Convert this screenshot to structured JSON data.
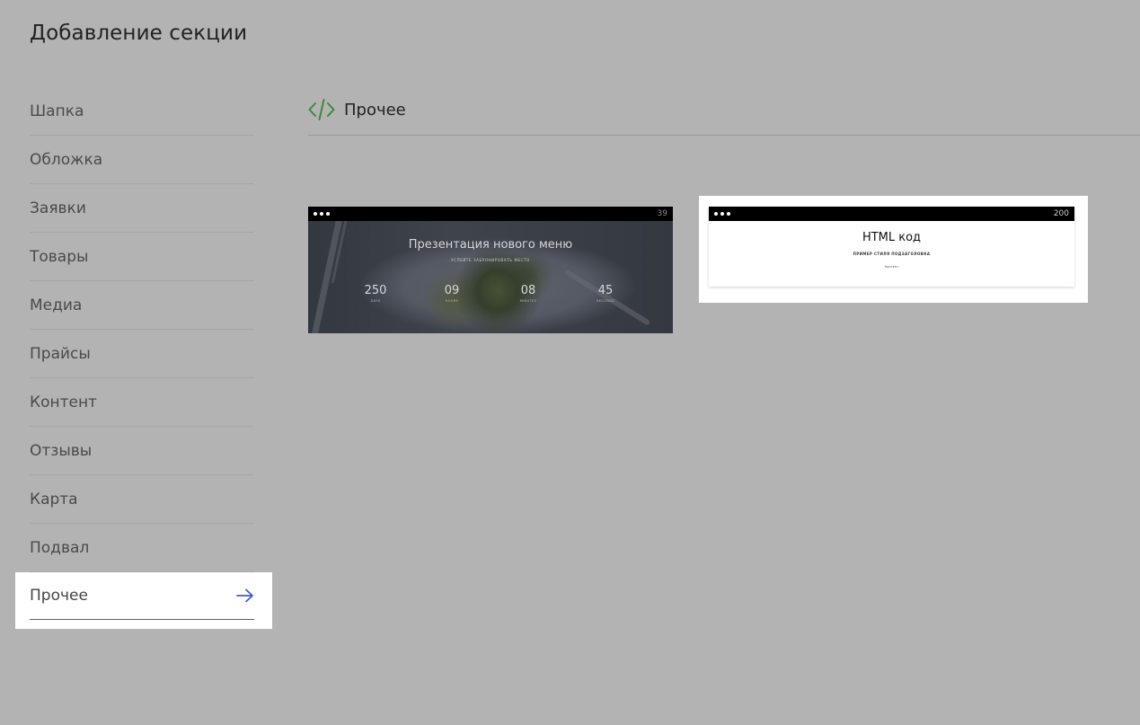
{
  "page_title": "Добавление секции",
  "sidebar": {
    "items": [
      {
        "label": "Шапка"
      },
      {
        "label": "Обложка"
      },
      {
        "label": "Заявки"
      },
      {
        "label": "Товары"
      },
      {
        "label": "Медиа"
      },
      {
        "label": "Прайсы"
      },
      {
        "label": "Контент"
      },
      {
        "label": "Отзывы"
      },
      {
        "label": "Карта"
      },
      {
        "label": "Подвал"
      }
    ],
    "active": {
      "label": "Прочее",
      "icon": "arrow-right-icon"
    }
  },
  "section": {
    "title": "Прочее",
    "icon": "code-icon",
    "icon_color": "#3e8a3a"
  },
  "cards": [
    {
      "number": "39",
      "title": "Презентация нового меню",
      "subtitle": "УСПЕЙТЕ ЗАБРОНИРОВАТЬ МЕСТО",
      "counters": [
        {
          "value": "250",
          "label": "DAYS"
        },
        {
          "value": "09",
          "label": "HOURS"
        },
        {
          "value": "08",
          "label": "MINUTES"
        },
        {
          "value": "45",
          "label": "SECONDS"
        }
      ]
    },
    {
      "number": "200",
      "title": "HTML код",
      "subtitle": "ПРИМЕР СТИЛЯ ПОДЗАГОЛОВКА",
      "text": "Контент"
    }
  ],
  "colors": {
    "background": "#b3b3b3",
    "accent": "#3d5bd9"
  }
}
